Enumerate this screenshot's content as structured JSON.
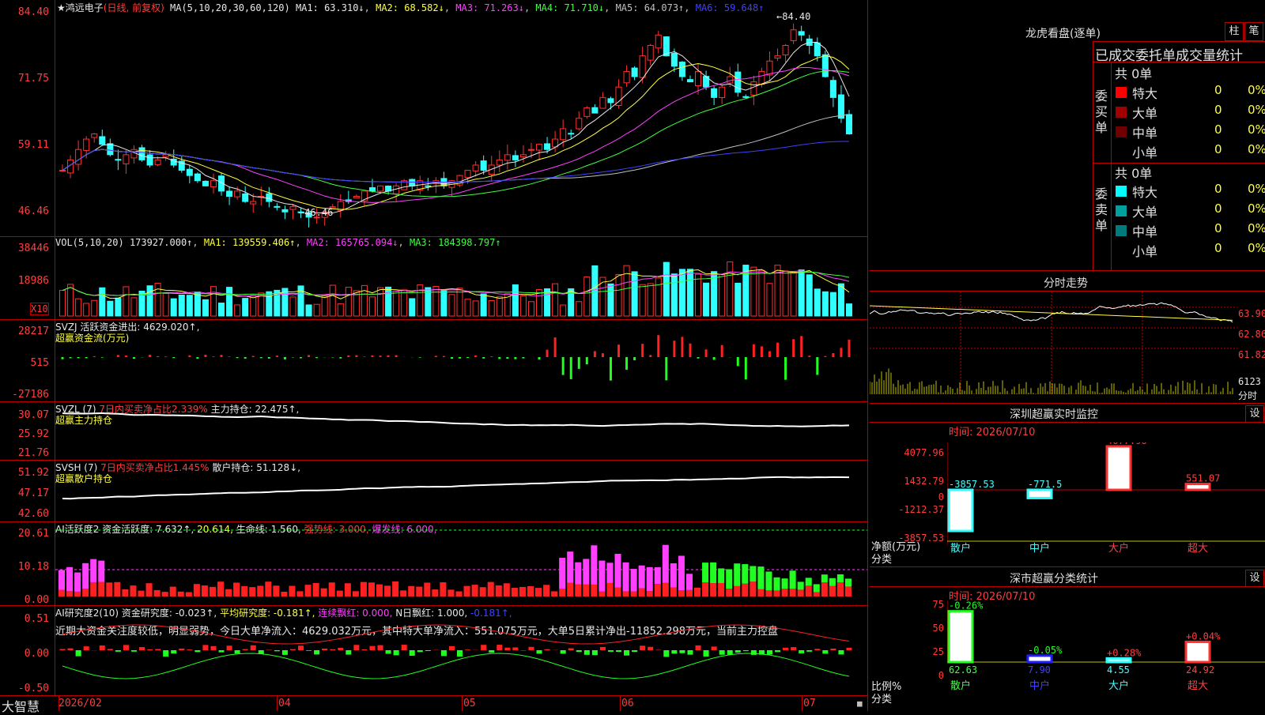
{
  "stock": {
    "name": "★鸿远电子",
    "mode": "(日线, 前复权)",
    "ma_label": "MA(5,10,20,30,60,120)",
    "ma": [
      {
        "label": "MA1: 63.310↓",
        "color": "#e8e8e8"
      },
      {
        "label": "MA2: 68.582↓",
        "color": "#ffff40"
      },
      {
        "label": "MA3: 71.263↓",
        "color": "#ff40ff"
      },
      {
        "label": "MA4: 71.710↓",
        "color": "#40ff40"
      },
      {
        "label": "MA5: 64.073↑",
        "color": "#c0c0c0"
      },
      {
        "label": "MA6: 59.648↑",
        "color": "#4040ff"
      }
    ],
    "price_axis": [
      "84.40",
      "71.75",
      "59.11",
      "46.46"
    ],
    "high_mark": "84.40",
    "low_mark": "46.46"
  },
  "volume": {
    "title": "VOL(5,10,20)",
    "value": "173927.000↑",
    "ma1": "MA1: 139559.406↑",
    "ma2": "MA2: 165765.094↓",
    "ma3": "MA3: 184398.797↑",
    "axis": [
      "38446",
      "18986"
    ],
    "unit": "X10"
  },
  "svzj": {
    "title": "SVZJ  活跃资金进出: 4629.020↑,",
    "subtitle": "超赢资金流(万元)",
    "axis": [
      "28217",
      "515",
      "-27186"
    ]
  },
  "svzl": {
    "title": "SVZL (7)",
    "desc": "7日内买卖净占比2.339%",
    "hold": "主力持仓: 22.475↑,",
    "subtitle": "超赢主力持仓",
    "axis": [
      "30.07",
      "25.92",
      "21.76"
    ]
  },
  "svsh": {
    "title": "SVSH (7)",
    "desc": "7日内买卖净占比1.445%",
    "hold": "散户持仓: 51.128↓,",
    "subtitle": "超赢散户持仓",
    "axis": [
      "51.92",
      "47.17",
      "42.60"
    ]
  },
  "ai_active": {
    "title": "AI活跃度2 资金活跃度: 7.632↑,",
    "v2": "20.614,",
    "life": "生命线: 1.560,",
    "strong": "强势线: 3.000,",
    "burst": "爆发线: 6.000,",
    "axis": [
      "20.61",
      "10.18",
      "0.00"
    ]
  },
  "ai_research": {
    "title": "AI研究度2(10) 资金研究度: -0.023↑,",
    "avg": "平均研究度: -0.181↑,",
    "red": "连续飘红: 0.000,",
    "nday": "N日飘红: 1.000,",
    "last": "-0.181↑,",
    "comment": "近期大资金关注度较低，明显弱势，今日大单净流入：4629.032万元，其中特大单净流入：551.075万元，大单5日累计净出-11852.298万元，当前主力控盘",
    "axis": [
      "0.51",
      "0.00",
      "-0.50"
    ]
  },
  "date_axis": [
    "2026/02",
    "04",
    "05",
    "06",
    "07"
  ],
  "footer_brand": "大智慧",
  "dragon": {
    "title": "龙虎看盘(逐单)",
    "btn1": "柱",
    "btn2": "笔",
    "header": "已成交委托单成交量统计",
    "buy_label": "委买单",
    "sell_label": "委卖单",
    "buy_total": "共 0单",
    "sell_total": "共 0单",
    "buy_rows": [
      {
        "name": "特大",
        "count": "0",
        "pct": "0%",
        "color": "#ff0000"
      },
      {
        "name": "大单",
        "count": "0",
        "pct": "0%",
        "color": "#a00000"
      },
      {
        "name": "中单",
        "count": "0",
        "pct": "0%",
        "color": "#700000"
      },
      {
        "name": "小单",
        "count": "0",
        "pct": "0%",
        "color": "#000000"
      }
    ],
    "sell_rows": [
      {
        "name": "特大",
        "count": "0",
        "pct": "0%",
        "color": "#00ffff"
      },
      {
        "name": "大单",
        "count": "0",
        "pct": "0%",
        "color": "#00a0a0"
      },
      {
        "name": "中单",
        "count": "0",
        "pct": "0%",
        "color": "#007a7a"
      },
      {
        "name": "小单",
        "count": "0",
        "pct": "0%",
        "color": "#000000"
      }
    ]
  },
  "intraday": {
    "title": "分时走势",
    "axis": [
      "63.90",
      "62.86",
      "61.82"
    ],
    "vol": "6123",
    "label": "分时"
  },
  "monitor": {
    "title": "深圳超赢实时监控",
    "btn": "设",
    "time": "时间: 2026/07/10",
    "axis": [
      "4077.96",
      "1432.79",
      "0",
      "-1212.37",
      "-3857.53"
    ],
    "unit_label": "净额(万元)",
    "cat_label": "分类",
    "bars": [
      {
        "name": "散户",
        "value": "-3857.53"
      },
      {
        "name": "中户",
        "value": "-771.5"
      },
      {
        "name": "大户",
        "value": "4077.96"
      },
      {
        "name": "超大",
        "value": "551.07"
      }
    ]
  },
  "classify": {
    "title": "深市超赢分类统计",
    "btn": "设",
    "time": "时间: 2026/07/10",
    "axis": [
      "75",
      "50",
      "25",
      "0"
    ],
    "ratio_label": "比例%",
    "cat_label": "分类",
    "bars": [
      {
        "name": "散户",
        "value": "62.63",
        "chg": "-0.26%"
      },
      {
        "name": "中户",
        "value": "7.90",
        "chg": "-0.05%"
      },
      {
        "name": "大户",
        "value": "4.55",
        "chg": "+0.28%"
      },
      {
        "name": "超大",
        "value": "24.92",
        "chg": "+0.04%"
      }
    ]
  }
}
